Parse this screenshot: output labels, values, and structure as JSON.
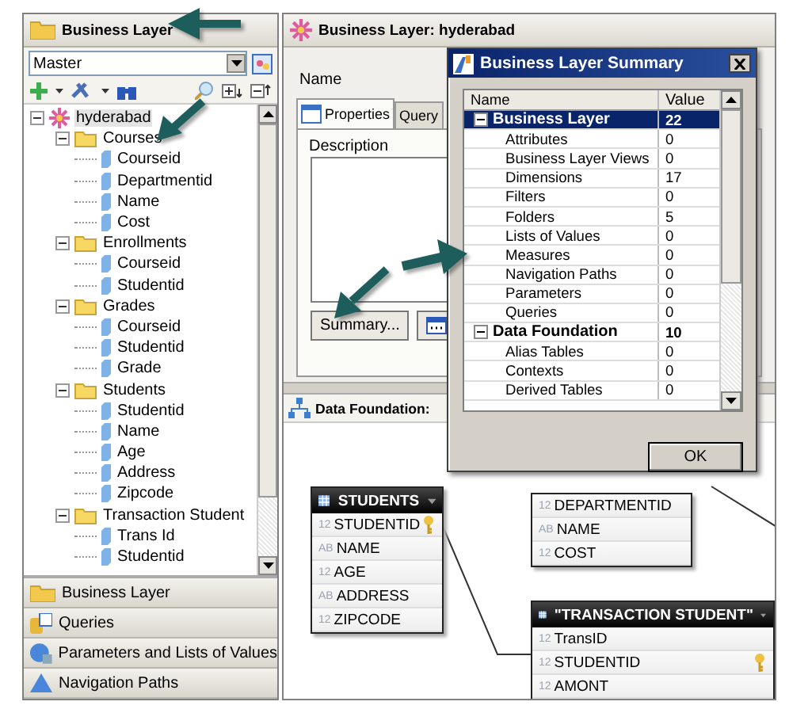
{
  "left_panel": {
    "title": "Business Layer",
    "combo": {
      "value": "Master"
    },
    "tree": [
      {
        "label": "hyderabad",
        "kind": "root",
        "expanded": true,
        "selected": true,
        "children": [
          {
            "label": "Courses",
            "kind": "folder",
            "expanded": true,
            "selected": false,
            "children": [
              {
                "label": "Courseid",
                "kind": "field",
                "selected": false
              },
              {
                "label": "Departmentid",
                "kind": "field",
                "selected": false
              },
              {
                "label": "Name",
                "kind": "field",
                "selected": false
              },
              {
                "label": "Cost",
                "kind": "field",
                "selected": false
              }
            ]
          },
          {
            "label": "Enrollments",
            "kind": "folder",
            "expanded": true,
            "selected": false,
            "children": [
              {
                "label": "Courseid",
                "kind": "field",
                "selected": false
              },
              {
                "label": "Studentid",
                "kind": "field",
                "selected": false
              }
            ]
          },
          {
            "label": "Grades",
            "kind": "folder",
            "expanded": true,
            "selected": false,
            "children": [
              {
                "label": "Courseid",
                "kind": "field",
                "selected": false
              },
              {
                "label": "Studentid",
                "kind": "field",
                "selected": false
              },
              {
                "label": "Grade",
                "kind": "field",
                "selected": false
              }
            ]
          },
          {
            "label": "Students",
            "kind": "folder",
            "expanded": true,
            "selected": false,
            "children": [
              {
                "label": "Studentid",
                "kind": "field",
                "selected": false
              },
              {
                "label": "Name",
                "kind": "field",
                "selected": false
              },
              {
                "label": "Age",
                "kind": "field",
                "selected": false
              },
              {
                "label": "Address",
                "kind": "field",
                "selected": false
              },
              {
                "label": "Zipcode",
                "kind": "field",
                "selected": false
              }
            ]
          },
          {
            "label": "Transaction Student",
            "kind": "folder",
            "expanded": true,
            "selected": false,
            "children": [
              {
                "label": "Trans Id",
                "kind": "field",
                "selected": false
              },
              {
                "label": "Studentid",
                "kind": "field",
                "selected": false
              }
            ]
          }
        ]
      }
    ],
    "accordion": [
      {
        "label": "Business Layer",
        "kind": "folder"
      },
      {
        "label": "Queries",
        "kind": "queries"
      },
      {
        "label": "Parameters and Lists of Values",
        "kind": "parameters"
      },
      {
        "label": "Navigation Paths",
        "kind": "paths"
      }
    ]
  },
  "editor": {
    "title": "Business Layer: hyderabad",
    "name_label": "Name",
    "tabs": [
      {
        "label": "Properties",
        "selected": true
      },
      {
        "label": "Query",
        "selected": false
      }
    ],
    "description_label": "Description",
    "summary_button": "Summary..."
  },
  "data_foundation": {
    "title": "Data Foundation:",
    "tables": [
      {
        "name": "STUDENTS",
        "columns": [
          {
            "type": "12",
            "name": "STUDENTID",
            "key": true
          },
          {
            "type": "AB",
            "name": "NAME",
            "key": false
          },
          {
            "type": "12",
            "name": "AGE",
            "key": false
          },
          {
            "type": "AB",
            "name": "ADDRESS",
            "key": false
          },
          {
            "type": "12",
            "name": "ZIPCODE",
            "key": false
          }
        ]
      },
      {
        "columns": [
          {
            "type": "12",
            "name": "DEPARTMENTID",
            "key": false
          },
          {
            "type": "AB",
            "name": "NAME",
            "key": false
          },
          {
            "type": "12",
            "name": "COST",
            "key": false
          }
        ]
      },
      {
        "name": "\"TRANSACTION STUDENT\"",
        "columns": [
          {
            "type": "12",
            "name": "TransID",
            "key": false
          },
          {
            "type": "12",
            "name": "STUDENTID",
            "key": true
          },
          {
            "type": "12",
            "name": "AMONT",
            "key": false
          }
        ]
      }
    ]
  },
  "dialog": {
    "title": "Business Layer Summary",
    "columns": [
      "Name",
      "Value"
    ],
    "rows": [
      {
        "kind": "group",
        "name": "Business Layer",
        "value": "22",
        "expanded": true,
        "selected": true
      },
      {
        "kind": "item",
        "name": "Attributes",
        "value": "0",
        "selected": false
      },
      {
        "kind": "item",
        "name": "Business Layer Views",
        "value": "0",
        "selected": false
      },
      {
        "kind": "item",
        "name": "Dimensions",
        "value": "17",
        "selected": false
      },
      {
        "kind": "item",
        "name": "Filters",
        "value": "0",
        "selected": false
      },
      {
        "kind": "item",
        "name": "Folders",
        "value": "5",
        "selected": false
      },
      {
        "kind": "item",
        "name": "Lists of Values",
        "value": "0",
        "selected": false
      },
      {
        "kind": "item",
        "name": "Measures",
        "value": "0",
        "selected": false
      },
      {
        "kind": "item",
        "name": "Navigation Paths",
        "value": "0",
        "selected": false
      },
      {
        "kind": "item",
        "name": "Parameters",
        "value": "0",
        "selected": false
      },
      {
        "kind": "item",
        "name": "Queries",
        "value": "0",
        "selected": false
      },
      {
        "kind": "group",
        "name": "Data Foundation",
        "value": "10",
        "expanded": true,
        "selected": false
      },
      {
        "kind": "item",
        "name": "Alias Tables",
        "value": "0",
        "selected": false
      },
      {
        "kind": "item",
        "name": "Contexts",
        "value": "0",
        "selected": false
      },
      {
        "kind": "item",
        "name": "Derived Tables",
        "value": "0",
        "selected": false
      }
    ],
    "ok_button": "OK"
  }
}
